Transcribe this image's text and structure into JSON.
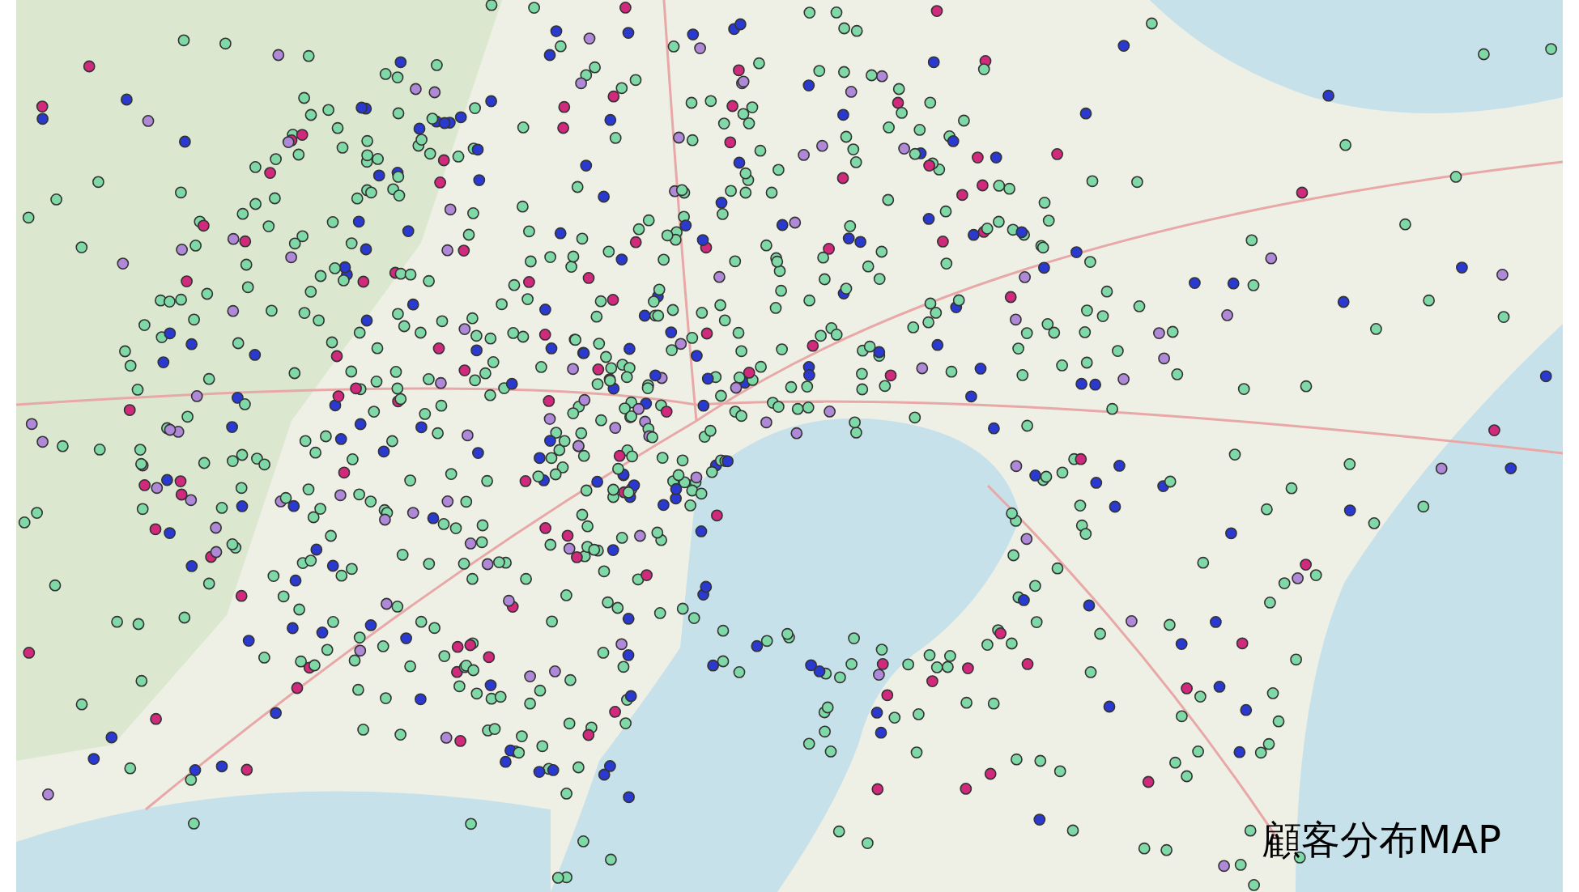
{
  "map": {
    "title": "顧客分布MAP"
  }
}
